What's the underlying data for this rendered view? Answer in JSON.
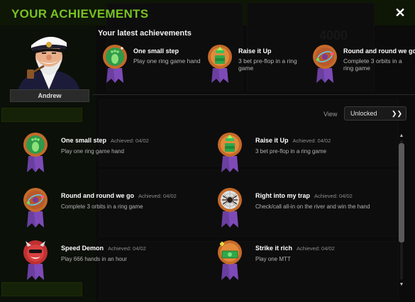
{
  "header": {
    "title": "YOUR ACHIEVEMENTS",
    "close_label": "✕"
  },
  "user": {
    "name": "Andrew"
  },
  "latest": {
    "title": "Your latest achievements",
    "items": [
      {
        "name": "One small step",
        "desc": "Play one ring game hand",
        "icon": "footprint"
      },
      {
        "name": "Raise it Up",
        "desc": "3 bet pre-flop in a ring game",
        "icon": "chip-stack"
      },
      {
        "name": "Round and round we go",
        "desc": "Complete 3 orbits in a ring game",
        "icon": "orbit"
      }
    ]
  },
  "view": {
    "label": "View",
    "selected": "Unlocked"
  },
  "achievements": [
    {
      "name": "One small step",
      "date": "Achieved: 04/02",
      "desc": "Play one ring game hand",
      "icon": "footprint"
    },
    {
      "name": "Raise it Up",
      "date": "Achieved: 04/02",
      "desc": "3 bet pre-flop in a ring game",
      "icon": "chip-stack"
    },
    {
      "name": "Round and round we go",
      "date": "Achieved: 04/02",
      "desc": "Complete 3 orbits in a ring game",
      "icon": "orbit"
    },
    {
      "name": "Right into my trap",
      "date": "Achieved: 04/02",
      "desc": "Check/call all-in on the river and win the hand",
      "icon": "spider"
    },
    {
      "name": "Speed Demon",
      "date": "Achieved: 04/02",
      "desc": "Play 666 hands in an hour",
      "icon": "demon"
    },
    {
      "name": "Strike it rich",
      "date": "Achieved: 04/02",
      "desc": "Play one MTT",
      "icon": "money"
    }
  ],
  "colors": {
    "accent": "#79c222",
    "medal_bronze": "#c46a2a",
    "ribbon": "#6b3fa0"
  }
}
